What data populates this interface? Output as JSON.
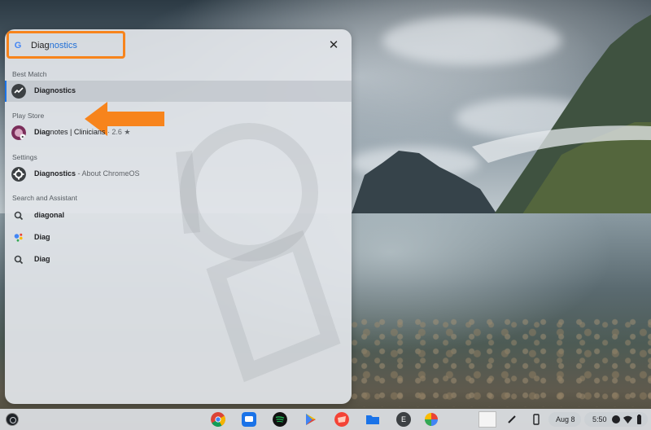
{
  "search": {
    "typed": "Diag",
    "suggested": "nostics"
  },
  "sections": {
    "best_match": "Best Match",
    "play_store": "Play Store",
    "settings": "Settings",
    "search_assistant": "Search and Assistant"
  },
  "results": {
    "best_match": {
      "bold": "Diagnostics",
      "icon": "diagnostics-icon"
    },
    "play_store": {
      "bold": "Diag",
      "rest": "notes | Clinicians",
      "rating": "· 2.6 ★",
      "icon": "diagnotes-app-icon"
    },
    "settings": {
      "bold": "Diagnostics",
      "sub": " - About ChromeOS",
      "icon": "settings-gear-icon"
    },
    "suggestions": [
      {
        "prefix": "diag",
        "rest": "onal",
        "icon": "search-icon"
      },
      {
        "prefix": "Diag",
        "rest": "",
        "icon": "google-assistant-icon"
      },
      {
        "prefix": "Diag",
        "rest": "",
        "icon": "search-icon"
      }
    ]
  },
  "shelf": {
    "date": "Aug 8",
    "time": "5:50",
    "letter_app": "E"
  },
  "colors": {
    "highlight": "#f7841c",
    "selection_accent": "#1a73e8",
    "link_blue": "#1f6fd6"
  }
}
